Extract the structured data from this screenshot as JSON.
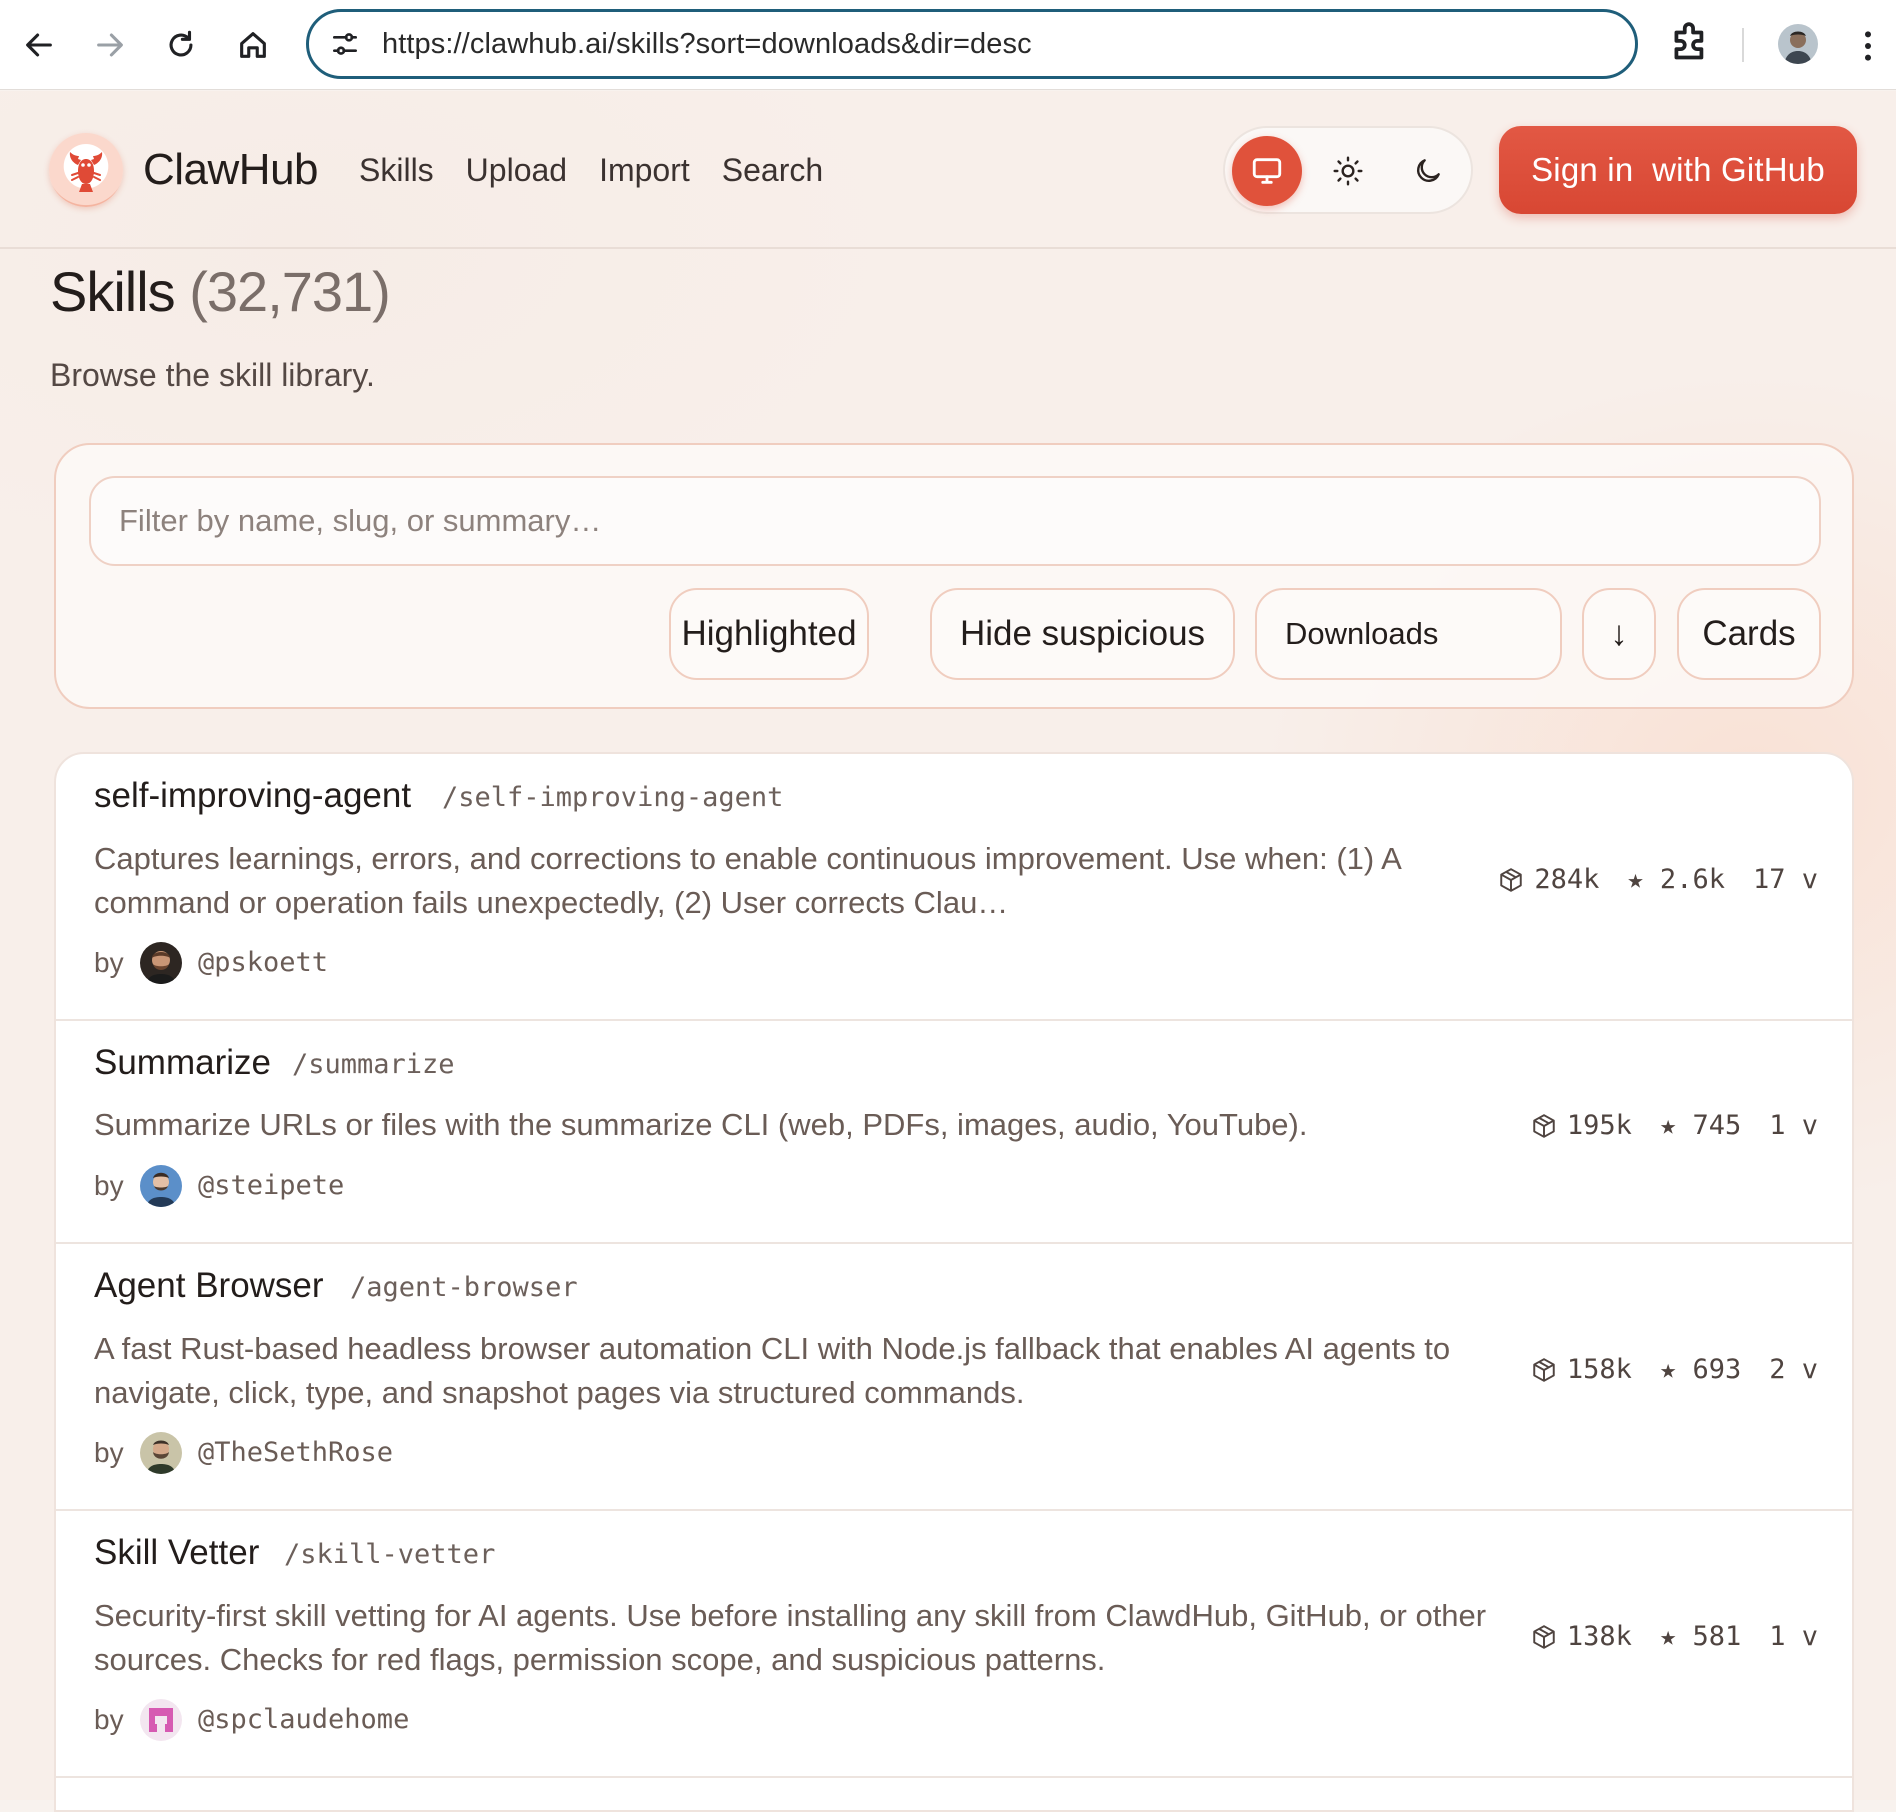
{
  "browser": {
    "url": "https://clawhub.ai/skills?sort=downloads&dir=desc"
  },
  "site": {
    "brand": "ClawHub",
    "nav": [
      "Skills",
      "Upload",
      "Import",
      "Search"
    ],
    "theme_modes": [
      "system",
      "light",
      "dark"
    ],
    "active_theme": "system",
    "signin_label": "Sign in  with GitHub",
    "accent_color": "#e0523b"
  },
  "page": {
    "title": "Skills",
    "count": "(32,731)",
    "subtitle": "Browse the skill library."
  },
  "filters": {
    "placeholder": "Filter by name, slug, or summary…",
    "highlighted_label": "Highlighted",
    "hide_suspicious_label": "Hide suspicious",
    "sort_value": "Downloads",
    "direction_icon": "↓",
    "view_label": "Cards"
  },
  "skills": [
    {
      "name": "self-improving-agent",
      "slug": "/self-improving-agent",
      "summary": "Captures learnings, errors, and corrections to enable continuous improvement. Use when: (1) A command or operation fails unexpectedly, (2) User corrects Clau…",
      "by": "by",
      "author": "@pskoett",
      "downloads": "284k",
      "stars": "★ 2.6k",
      "versions": "17 v"
    },
    {
      "name": "Summarize",
      "slug": "/summarize",
      "summary": "Summarize URLs or files with the summarize CLI (web, PDFs, images, audio, YouTube).",
      "by": "by",
      "author": "@steipete",
      "downloads": "195k",
      "stars": "★ 745",
      "versions": "1 v"
    },
    {
      "name": "Agent Browser",
      "slug": "/agent-browser",
      "summary": "A fast Rust-based headless browser automation CLI with Node.js fallback that enables AI agents to navigate, click, type, and snapshot pages via structured commands.",
      "by": "by",
      "author": "@TheSethRose",
      "downloads": "158k",
      "stars": "★ 693",
      "versions": "2 v"
    },
    {
      "name": "Skill Vetter",
      "slug": "/skill-vetter",
      "summary": "Security-first skill vetting for AI agents. Use before installing any skill from ClawdHub, GitHub, or other sources. Checks for red flags, permission scope, and suspicious patterns.",
      "by": "by",
      "author": "@spclaudehome",
      "downloads": "138k",
      "stars": "★ 581",
      "versions": "1 v"
    }
  ]
}
